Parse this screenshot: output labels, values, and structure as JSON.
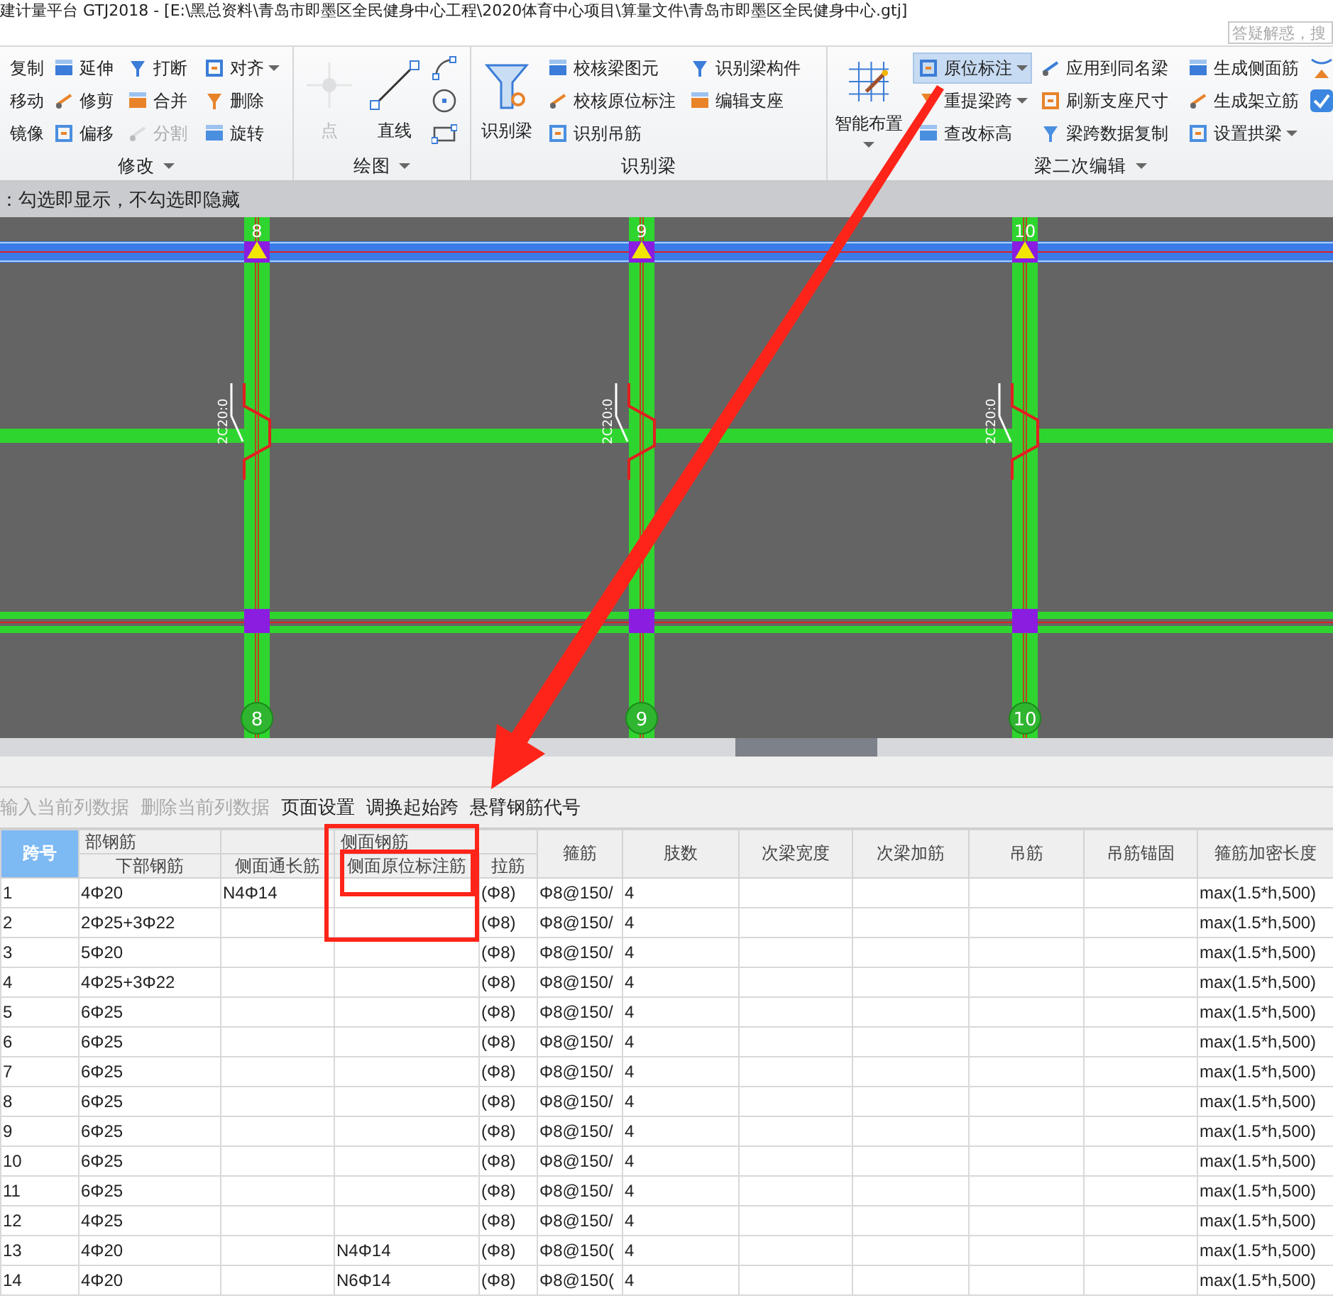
{
  "window": {
    "title": "建计量平台 GTJ2018 - [E:\\黑总资料\\青岛市即墨区全民健身中心工程\\2020体育中心项目\\算量文件\\青岛市即墨区全民健身中心.gtj]"
  },
  "search": {
    "placeholder": "答疑解惑，搜"
  },
  "ribbon": {
    "groups": [
      {
        "label": "修改",
        "dropdown": true,
        "columns": [
          [
            {
              "kind": "label_only",
              "label": "复制",
              "disabled": false,
              "selected": false,
              "dropdown": false
            },
            {
              "kind": "label_only",
              "label": "移动",
              "disabled": false,
              "selected": false,
              "dropdown": false
            },
            {
              "kind": "label_only",
              "label": "镜像",
              "disabled": false,
              "selected": false,
              "dropdown": false
            }
          ],
          [
            {
              "kind": "small",
              "label": "延伸",
              "disabled": false,
              "selected": false,
              "dropdown": false
            },
            {
              "kind": "small",
              "label": "修剪",
              "disabled": false,
              "selected": false,
              "dropdown": false
            },
            {
              "kind": "small",
              "label": "偏移",
              "disabled": false,
              "selected": false,
              "dropdown": false
            }
          ],
          [
            {
              "kind": "small",
              "label": "打断",
              "disabled": false,
              "selected": false,
              "dropdown": false
            },
            {
              "kind": "small",
              "label": "合并",
              "disabled": false,
              "selected": false,
              "dropdown": false
            },
            {
              "kind": "small",
              "label": "分割",
              "disabled": true,
              "selected": false,
              "dropdown": false
            }
          ],
          [
            {
              "kind": "small",
              "label": "对齐",
              "disabled": false,
              "selected": false,
              "dropdown": true
            },
            {
              "kind": "small",
              "label": "删除",
              "disabled": false,
              "selected": false,
              "dropdown": false
            },
            {
              "kind": "small",
              "label": "旋转",
              "disabled": false,
              "selected": false,
              "dropdown": false
            }
          ]
        ]
      },
      {
        "label": "绘图",
        "dropdown": true,
        "columns": [
          [
            {
              "kind": "large",
              "label": "点",
              "disabled": true,
              "selected": false,
              "dropdown": false
            }
          ],
          [
            {
              "kind": "large",
              "label": "直线",
              "disabled": false,
              "selected": false,
              "dropdown": false
            }
          ],
          [
            {
              "kind": "icon_only",
              "disabled": false,
              "selected": false
            },
            {
              "kind": "icon_only",
              "disabled": false,
              "selected": false
            },
            {
              "kind": "icon_only",
              "disabled": false,
              "selected": false
            }
          ]
        ]
      },
      {
        "label": "识别梁",
        "dropdown": false,
        "columns": [
          [
            {
              "kind": "large",
              "label": "识别梁",
              "disabled": false,
              "selected": false,
              "dropdown": false
            }
          ],
          [
            {
              "kind": "small",
              "label": "校核梁图元",
              "disabled": false,
              "selected": false,
              "dropdown": false
            },
            {
              "kind": "small",
              "label": "校核原位标注",
              "disabled": false,
              "selected": false,
              "dropdown": false
            },
            {
              "kind": "small",
              "label": "识别吊筋",
              "disabled": false,
              "selected": false,
              "dropdown": false
            }
          ],
          [
            {
              "kind": "small",
              "label": "识别梁构件",
              "disabled": false,
              "selected": false,
              "dropdown": false
            },
            {
              "kind": "small",
              "label": "编辑支座",
              "disabled": false,
              "selected": false,
              "dropdown": false
            }
          ]
        ]
      },
      {
        "label": "梁二次编辑",
        "dropdown": true,
        "columns": [
          [
            {
              "kind": "large",
              "label": "智能布置",
              "disabled": false,
              "selected": false,
              "dropdown": true
            }
          ],
          [
            {
              "kind": "small",
              "label": "原位标注",
              "disabled": false,
              "selected": true,
              "dropdown": true
            },
            {
              "kind": "small",
              "label": "重提梁跨",
              "disabled": false,
              "selected": false,
              "dropdown": true
            },
            {
              "kind": "small",
              "label": "查改标高",
              "disabled": false,
              "selected": false,
              "dropdown": false
            }
          ],
          [
            {
              "kind": "small",
              "label": "应用到同名梁",
              "disabled": false,
              "selected": false,
              "dropdown": false
            },
            {
              "kind": "small",
              "label": "刷新支座尺寸",
              "disabled": false,
              "selected": false,
              "dropdown": false
            },
            {
              "kind": "small",
              "label": "梁跨数据复制",
              "disabled": false,
              "selected": false,
              "dropdown": false
            }
          ],
          [
            {
              "kind": "small",
              "label": "生成侧面筋",
              "disabled": false,
              "selected": false,
              "dropdown": false
            },
            {
              "kind": "small",
              "label": "生成架立筋",
              "disabled": false,
              "selected": false,
              "dropdown": false
            },
            {
              "kind": "small",
              "label": "设置拱梁",
              "disabled": false,
              "selected": false,
              "dropdown": true
            }
          ],
          [
            {
              "kind": "icon_only",
              "disabled": false,
              "selected": false
            },
            {
              "kind": "icon_only",
              "disabled": false,
              "selected": false
            }
          ]
        ]
      }
    ]
  },
  "hint": "：勾选即显示，不勾选即隐藏",
  "canvas": {
    "axes": [
      {
        "top_label": "8",
        "bottom_label": "8",
        "rebar_label": "2C20:0"
      },
      {
        "top_label": "9",
        "bottom_label": "9",
        "rebar_label": "2C20:0"
      },
      {
        "top_label": "10",
        "bottom_label": "10",
        "rebar_label": "2C20:0"
      }
    ]
  },
  "table_toolbar": [
    {
      "label": "输入当前列数据",
      "disabled": true
    },
    {
      "label": "删除当前列数据",
      "disabled": true
    },
    {
      "label": "页面设置",
      "disabled": false
    },
    {
      "label": "调换起始跨",
      "disabled": false
    },
    {
      "label": "悬臂钢筋代号",
      "disabled": false
    }
  ],
  "table": {
    "columns": [
      {
        "kind": "single",
        "label": "跨号",
        "selected": true
      },
      {
        "kind": "grouped",
        "label": "下部钢筋",
        "group": "部钢筋",
        "selected": false
      },
      {
        "kind": "lower",
        "label": "侧面通长筋",
        "selected": false
      },
      {
        "kind": "grouped",
        "label": "侧面原位标注筋",
        "group": "侧面钢筋",
        "selected": false
      },
      {
        "kind": "continued",
        "label": "拉筋",
        "selected": false
      },
      {
        "kind": "single",
        "label": "箍筋",
        "selected": false
      },
      {
        "kind": "single",
        "label": "肢数",
        "selected": false
      },
      {
        "kind": "single",
        "label": "次梁宽度",
        "selected": false
      },
      {
        "kind": "single",
        "label": "次梁加筋",
        "selected": false
      },
      {
        "kind": "single",
        "label": "吊筋",
        "selected": false
      },
      {
        "kind": "single",
        "label": "吊筋锚固",
        "selected": false
      },
      {
        "kind": "single",
        "label": "箍筋加密长度",
        "selected": false
      }
    ],
    "rows": [
      [
        "1",
        "4Φ20",
        "N4Φ14",
        null,
        "(Φ8)",
        "Φ8@150/",
        "4",
        null,
        null,
        null,
        null,
        "max(1.5*h,500)"
      ],
      [
        "2",
        "2Φ25+3Φ22",
        null,
        null,
        "(Φ8)",
        "Φ8@150/",
        "4",
        null,
        null,
        null,
        null,
        "max(1.5*h,500)"
      ],
      [
        "3",
        "5Φ20",
        null,
        null,
        "(Φ8)",
        "Φ8@150/",
        "4",
        null,
        null,
        null,
        null,
        "max(1.5*h,500)"
      ],
      [
        "4",
        "4Φ25+3Φ22",
        null,
        null,
        "(Φ8)",
        "Φ8@150/",
        "4",
        null,
        null,
        null,
        null,
        "max(1.5*h,500)"
      ],
      [
        "5",
        "6Φ25",
        null,
        null,
        "(Φ8)",
        "Φ8@150/",
        "4",
        null,
        null,
        null,
        null,
        "max(1.5*h,500)"
      ],
      [
        "6",
        "6Φ25",
        null,
        null,
        "(Φ8)",
        "Φ8@150/",
        "4",
        null,
        null,
        null,
        null,
        "max(1.5*h,500)"
      ],
      [
        "7",
        "6Φ25",
        null,
        null,
        "(Φ8)",
        "Φ8@150/",
        "4",
        null,
        null,
        null,
        null,
        "max(1.5*h,500)"
      ],
      [
        "8",
        "6Φ25",
        null,
        null,
        "(Φ8)",
        "Φ8@150/",
        "4",
        null,
        null,
        null,
        null,
        "max(1.5*h,500)"
      ],
      [
        "9",
        "6Φ25",
        null,
        null,
        "(Φ8)",
        "Φ8@150/",
        "4",
        null,
        null,
        null,
        null,
        "max(1.5*h,500)"
      ],
      [
        "10",
        "6Φ25",
        null,
        null,
        "(Φ8)",
        "Φ8@150/",
        "4",
        null,
        null,
        null,
        null,
        "max(1.5*h,500)"
      ],
      [
        "11",
        "6Φ25",
        null,
        null,
        "(Φ8)",
        "Φ8@150/",
        "4",
        null,
        null,
        null,
        null,
        "max(1.5*h,500)"
      ],
      [
        "12",
        "4Φ25",
        null,
        null,
        "(Φ8)",
        "Φ8@150/",
        "4",
        null,
        null,
        null,
        null,
        "max(1.5*h,500)"
      ],
      [
        "13",
        "4Φ20",
        null,
        "N4Φ14",
        "(Φ8)",
        "Φ8@150(",
        "4",
        null,
        null,
        null,
        null,
        "max(1.5*h,500)"
      ],
      [
        "14",
        "4Φ20",
        null,
        "N6Φ14",
        "(Φ8)",
        "Φ8@150(",
        "4",
        null,
        null,
        null,
        null,
        "max(1.5*h,500)"
      ]
    ]
  }
}
